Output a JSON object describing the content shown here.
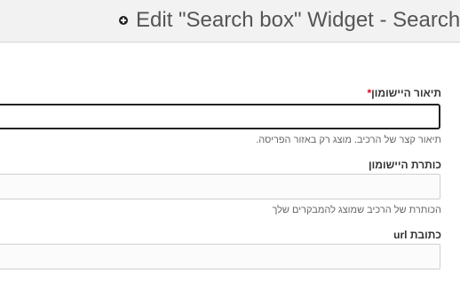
{
  "header": {
    "title": "Edit \"Search box\" Widget - Search",
    "icon": "add-circle-icon"
  },
  "form": {
    "app_description": {
      "label": "תיאור היישומון",
      "required_marker": "*",
      "value": "",
      "help": "תיאור קצר של הרכיב. מוצג רק באזור הפריסה."
    },
    "app_title": {
      "label": "כותרת היישומון",
      "value": "",
      "help": "הכותרת של הרכיב שמוצג להמבקרים שלך"
    },
    "url": {
      "label": "כתובת url",
      "value": ""
    }
  }
}
